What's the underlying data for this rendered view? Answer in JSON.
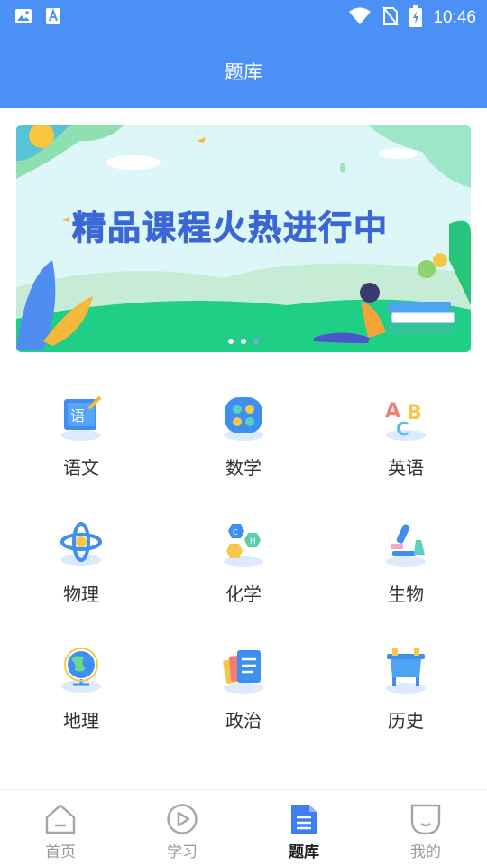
{
  "statusbar": {
    "time": "10:46"
  },
  "header": {
    "title": "题库"
  },
  "banner": {
    "headline": "精品课程火热进行中",
    "dots": 3,
    "active_dot": 2
  },
  "subjects": [
    {
      "label": "语文",
      "icon": "chinese-book-icon"
    },
    {
      "label": "数学",
      "icon": "calculator-icon"
    },
    {
      "label": "英语",
      "icon": "abc-letters-icon"
    },
    {
      "label": "物理",
      "icon": "atom-icon"
    },
    {
      "label": "化学",
      "icon": "molecule-icon"
    },
    {
      "label": "生物",
      "icon": "microscope-icon"
    },
    {
      "label": "地理",
      "icon": "globe-icon"
    },
    {
      "label": "政治",
      "icon": "documents-icon"
    },
    {
      "label": "历史",
      "icon": "ancient-vessel-icon"
    }
  ],
  "nav": [
    {
      "label": "首页",
      "icon": "home-icon"
    },
    {
      "label": "学习",
      "icon": "play-icon"
    },
    {
      "label": "题库",
      "icon": "question-bank-icon",
      "active": true
    },
    {
      "label": "我的",
      "icon": "profile-icon"
    }
  ],
  "colors": {
    "primary": "#4a90f5",
    "banner_text": "#3a66d6"
  }
}
